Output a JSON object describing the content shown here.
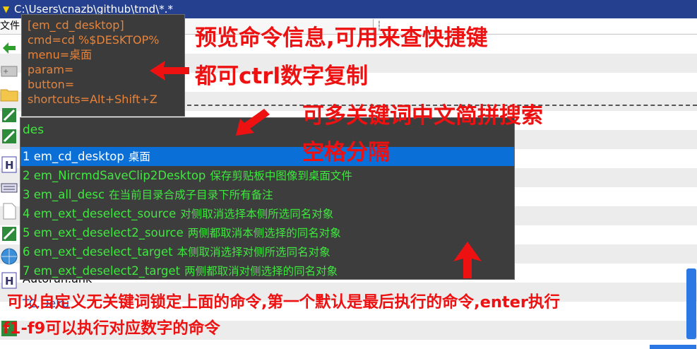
{
  "window": {
    "title": "C:\\Users\\cnazb\\github\\tmd\\*.*",
    "menu_first": "文件",
    "colors": {
      "titlebar": "#25408e",
      "accent_blue": "#0a6fd6",
      "annotation_red": "#ee1111",
      "result_green": "#3ee83e",
      "info_orange": "#e7833a"
    }
  },
  "background_files": [
    {
      "name": "Autorun.ahk",
      "icon": "h-file-icon"
    },
    {
      "name": "TC.Deku",
      "icon": "h-file-icon"
    },
    {
      "name": "Ini",
      "icon": "ini-file-icon"
    }
  ],
  "side_icons": [
    "back-arrow-icon",
    "folder-add-icon",
    "folder-icon",
    "tool-icon",
    "tool-icon",
    "h-file-icon",
    "keyboard-icon",
    "document-icon",
    "tool-icon",
    "globe-icon",
    "h-file-icon",
    "exe-icon"
  ],
  "info_box": {
    "lines": [
      "[em_cd_desktop]",
      "cmd=cd %$DESKTOP%",
      "menu=桌面",
      "param=",
      "button=",
      "shortcuts=Alt+Shift+Z"
    ]
  },
  "search": {
    "query": "des",
    "results": [
      {
        "index": "1",
        "command": "em_cd_desktop",
        "description": "桌面",
        "selected": true
      },
      {
        "index": "2",
        "command": "em_NircmdSaveClip2Desktop",
        "description": "保存剪贴板中图像到桌面文件",
        "selected": false
      },
      {
        "index": "3",
        "command": "em_all_desc",
        "description": "在当前目录合成子目录下所有备注",
        "selected": false
      },
      {
        "index": "4",
        "command": "em_ext_deselect_source",
        "description": "对侧取消选择本侧所选同名对象",
        "selected": false
      },
      {
        "index": "5",
        "command": "em_ext_deselect2_source",
        "description": "两侧都取消本侧选择的同名对象",
        "selected": false
      },
      {
        "index": "6",
        "command": "em_ext_deselect_target",
        "description": "本侧取消选择对侧所选同名对象",
        "selected": false
      },
      {
        "index": "7",
        "command": "em_ext_deselect2_target",
        "description": "两侧都取消对侧选择的同名对象",
        "selected": false
      }
    ]
  },
  "annotations": {
    "preview_info": "预览命令信息,可用来查快捷键",
    "ctrl_copy": "都可ctrl数字复制",
    "multi_keyword": "可多关键词中文简拼搜索",
    "space_separator": "空格分隔",
    "custom_keyword": "可以自定义无关键词锁定上面的命令,第一个默认是最后执行的命令,enter执行",
    "f1_f9": "f1-f9可以执行对应数字的命令"
  }
}
